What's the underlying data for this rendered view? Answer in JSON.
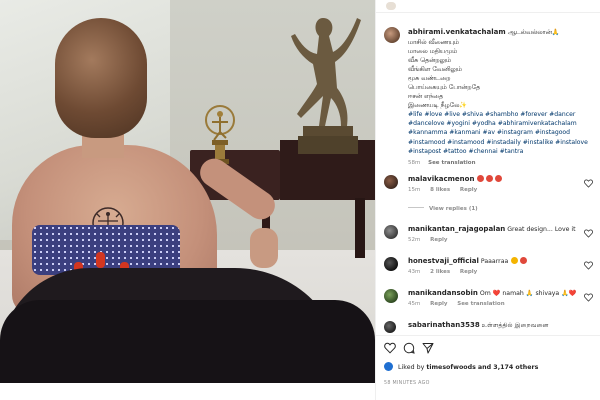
{
  "post": {
    "author": "abhirami.venkatachalam",
    "author_note": "ஆடல்வல்லான்🙏",
    "caption_lines": [
      "மாசில் வீணையும்",
      "மாலை மதியமும்",
      "வீசு தென்றலும்",
      "வீங்கிள வேனிலும்",
      "மூசு வண்டறை",
      "பொய்கையும் போன்றதே",
      "ஈசன் எந்தை",
      "இணையடி நீழலே✨"
    ],
    "hashtags": "#life #love #live #shiva #shambho #forever #dancer #dancelove #yogini #yodha #abhiramivenkatachalam #kannamma #kanmani #av #instagram #instagood #instamood #instamood #instadaily #instalike #instalove #instapost #tattoo #chennai #tantra",
    "caption_time": "58m",
    "see_translation": "See translation"
  },
  "comments": [
    {
      "user": "malavikacmenon",
      "text": "",
      "time": "15m",
      "likes": "8 likes",
      "reply": "Reply",
      "emoji_colors": [
        "#e0483b",
        "#e0483b",
        "#e0483b"
      ]
    },
    {
      "view_replies": "View replies (1)"
    },
    {
      "user": "manikantan_rajagopalan",
      "text": "Great design... Love it",
      "time": "52m",
      "reply": "Reply"
    },
    {
      "user": "honestvaji_official",
      "text": "Paaarraa",
      "time": "43m",
      "likes": "2 likes",
      "reply": "Reply",
      "emoji_colors": [
        "#f4b400",
        "#e0483b"
      ]
    },
    {
      "user": "manikandansobin",
      "text": "Om ❤️ namah 🙏 shivaya 🙏❤️",
      "time": "45m",
      "reply": "Reply",
      "see_translation": "See translation"
    },
    {
      "user": "sabarinathan3538",
      "text": "உள்ளத்தில் இறைவனை"
    }
  ],
  "reactions": {
    "liked_by_user": "timesofwoods",
    "liked_prefix": "Liked by",
    "liked_suffix": "and 3,174 others",
    "time_ago": "58 MINUTES AGO"
  },
  "colors": {
    "link": "#00376b",
    "muted": "#8e8e8e",
    "heart": "#262626"
  },
  "icons": [
    "heart-icon",
    "comment-icon",
    "share-icon"
  ]
}
